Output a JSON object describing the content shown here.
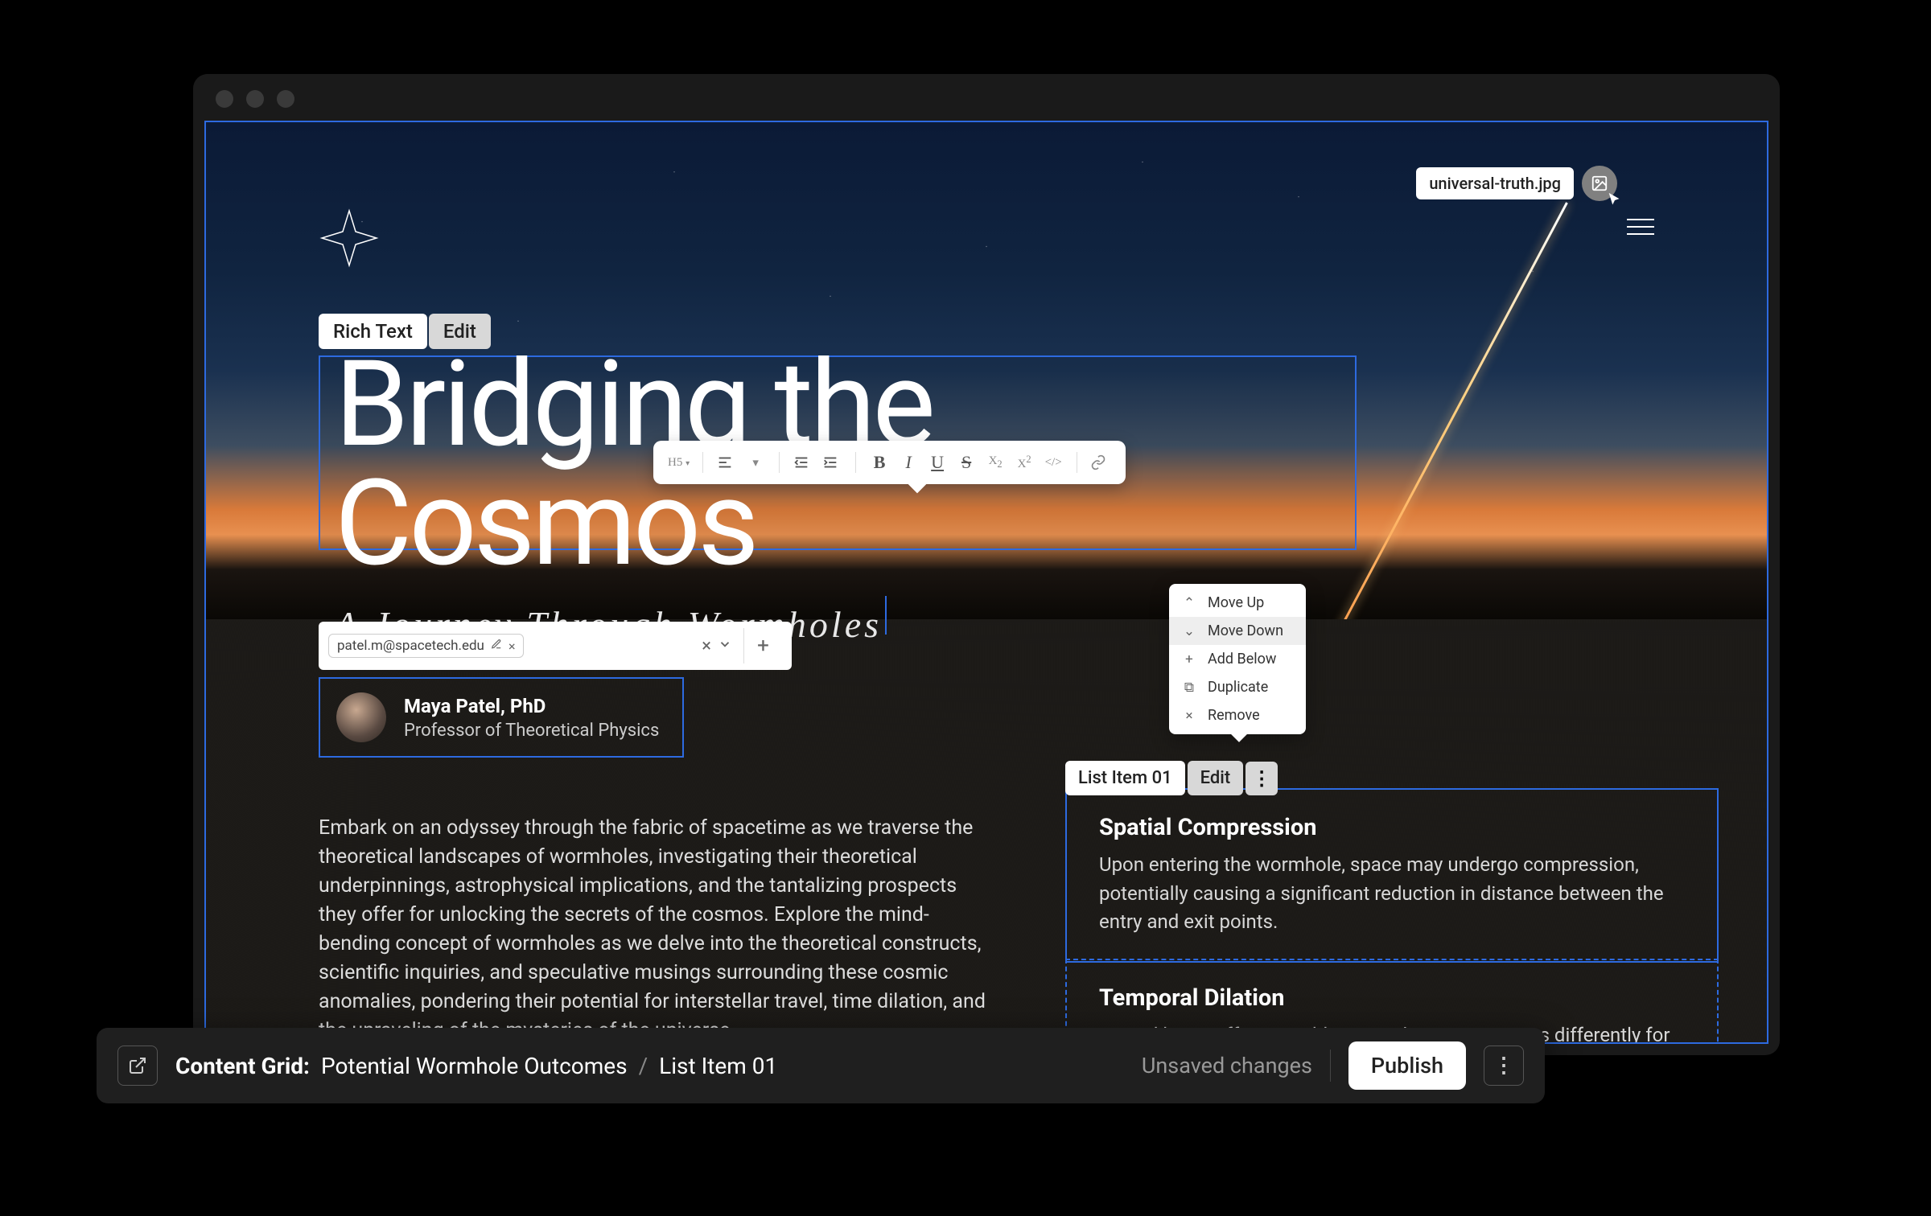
{
  "image_chip": {
    "filename": "universal-truth.jpg"
  },
  "richtext_pill": {
    "label": "Rich Text",
    "edit": "Edit"
  },
  "title": {
    "h1": "Bridging the Cosmos",
    "h2": "A Journey Through Wormholes"
  },
  "toolbar": {
    "heading": "H5"
  },
  "email": {
    "value": "patel.m@spacetech.edu"
  },
  "author": {
    "name": "Maya Patel, PhD",
    "role": "Professor of Theoretical Physics"
  },
  "body": "Embark on an odyssey through the fabric of spacetime as we traverse the theoretical landscapes of wormholes, investigating their theoretical underpinnings, astrophysical implications, and the tantalizing prospects they offer for unlocking the secrets of the cosmos. Explore the mind-bending concept of wormholes as we delve into the theoretical constructs, scientific inquiries, and speculative musings surrounding these cosmic anomalies, pondering their potential for interstellar travel, time dilation, and the unraveling of the mysteries of the universe.",
  "dropdown": {
    "items": [
      {
        "icon": "chevron-up",
        "label": "Move Up"
      },
      {
        "icon": "chevron-down",
        "label": "Move Down"
      },
      {
        "icon": "plus",
        "label": "Add Below"
      },
      {
        "icon": "duplicate",
        "label": "Duplicate"
      },
      {
        "icon": "close",
        "label": "Remove"
      }
    ],
    "active_index": 1
  },
  "list_item_pill": {
    "label": "List Item 01",
    "edit": "Edit"
  },
  "list_items": [
    {
      "title": "Spatial Compression",
      "body": "Upon entering the wormhole, space may undergo compression, potentially causing a significant reduction in distance between the entry and exit points."
    },
    {
      "title": "Temporal Dilation",
      "body": "Time dilation effects could occur, where time passes differently for observers outside."
    }
  ],
  "bottombar": {
    "group_label": "Content Grid:",
    "group_name": "Potential Wormhole Outcomes",
    "item": "List Item 01",
    "status": "Unsaved changes",
    "publish": "Publish"
  }
}
